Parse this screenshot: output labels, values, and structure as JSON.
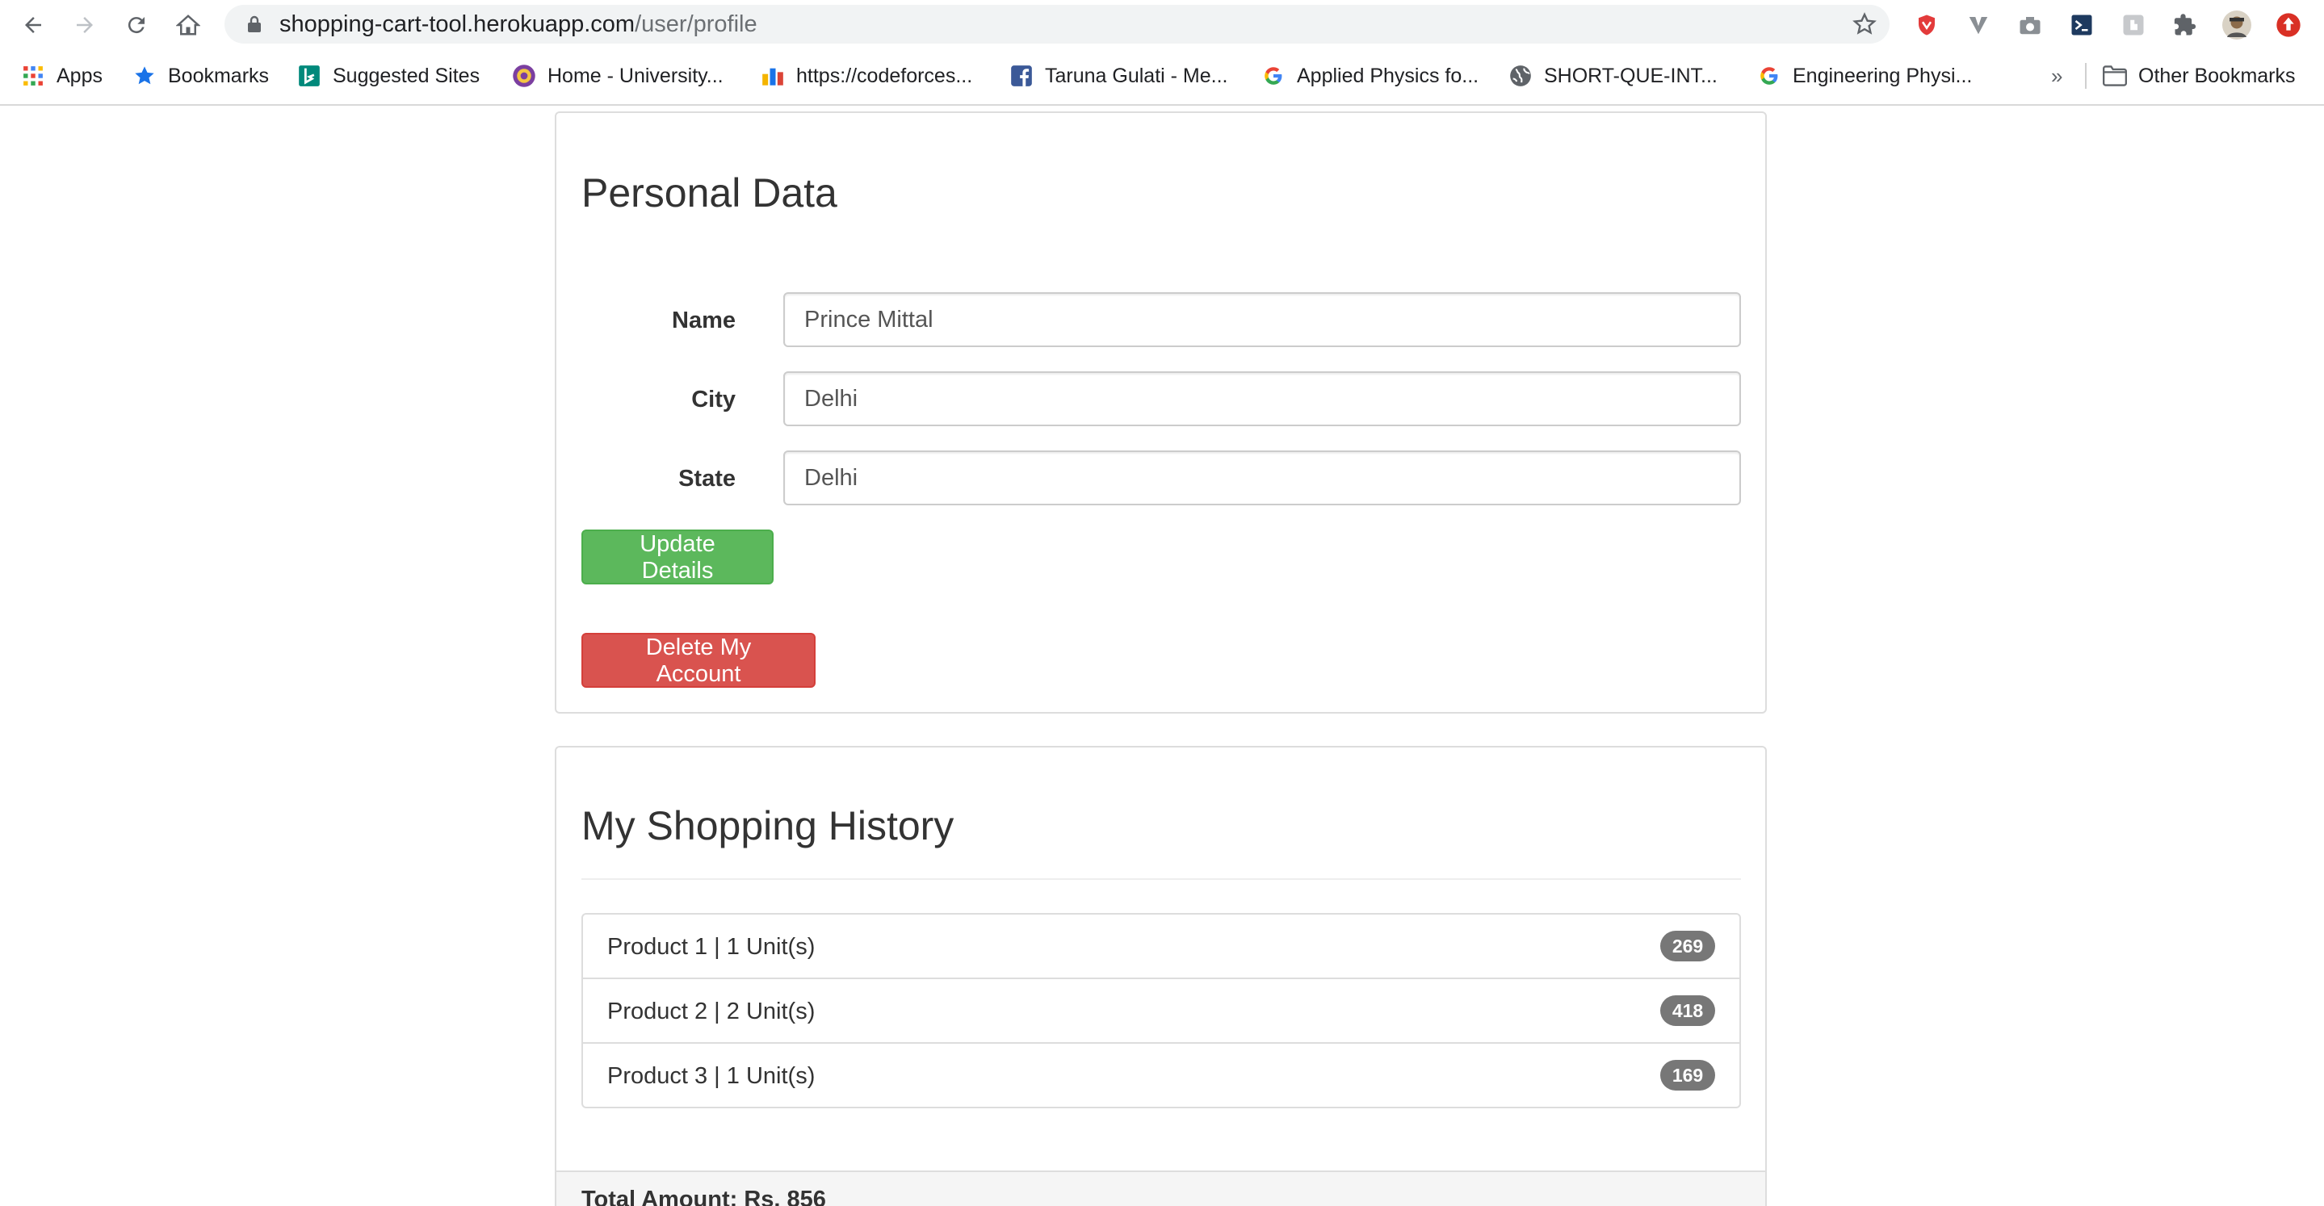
{
  "browser": {
    "url_host": "shopping-cart-tool.herokuapp.com",
    "url_path": "/user/profile",
    "bookmarks": [
      {
        "label": "Apps",
        "icon": "apps-grid-icon"
      },
      {
        "label": "Bookmarks",
        "icon": "star-icon"
      },
      {
        "label": "Suggested Sites",
        "icon": "bing-icon"
      },
      {
        "label": "Home - University...",
        "icon": "university-icon"
      },
      {
        "label": "https://codeforces...",
        "icon": "codeforces-icon"
      },
      {
        "label": "Taruna Gulati - Me...",
        "icon": "facebook-icon"
      },
      {
        "label": "Applied Physics fo...",
        "icon": "google-icon"
      },
      {
        "label": "SHORT-QUE-INT...",
        "icon": "globe-icon"
      },
      {
        "label": "Engineering Physi...",
        "icon": "google-icon"
      },
      {
        "label": "Other Bookmarks",
        "icon": "folder-icon"
      }
    ],
    "overflow_label": "»"
  },
  "personal": {
    "title": "Personal Data",
    "fields": [
      {
        "label": "Name",
        "value": "Prince Mittal"
      },
      {
        "label": "City",
        "value": "Delhi"
      },
      {
        "label": "State",
        "value": "Delhi"
      }
    ],
    "update_label": "Update Details",
    "delete_label": "Delete My Account"
  },
  "history": {
    "title": "My Shopping History",
    "items": [
      {
        "text": "Product 1 | 1 Unit(s)",
        "price": "269"
      },
      {
        "text": "Product 2 | 2 Unit(s)",
        "price": "418"
      },
      {
        "text": "Product 3 | 1 Unit(s)",
        "price": "169"
      }
    ],
    "total_label": "Total Amount: Rs. 856"
  },
  "colors": {
    "update_button": "#5cb85c",
    "delete_button": "#d9534f",
    "badge": "#777777"
  }
}
